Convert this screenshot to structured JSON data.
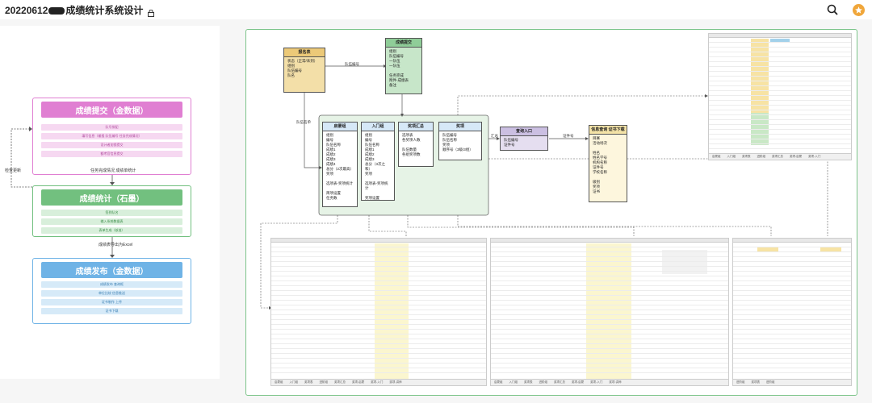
{
  "title_prefix": "20220612",
  "title_suffix": "成绩统计系统设计",
  "icons": {
    "lock": "lock-icon",
    "search": "search-icon",
    "star": "star-icon"
  },
  "colors": {
    "submit": "#e07fd2",
    "stats": "#72c07f",
    "publish": "#6fb3e6"
  },
  "flow": {
    "submit": {
      "title": "成绩提交（金数据）",
      "items": [
        "队号排配",
        "填写信息（输报 队伍编号 任务完成情况）",
        "设计者加锁提交",
        "额考官信息提交"
      ]
    },
    "stats": {
      "title": "成绩统计（石墨）",
      "items": [
        "签到队名",
        "输入系统数据表",
        "表单生成（核准）"
      ]
    },
    "publish": {
      "title": "成绩发布（金数据）",
      "items": [
        "成绩发布 查询框",
        "单位比较 信息推送",
        "证书制作 上传",
        "证书下载"
      ]
    },
    "note_between_1": "任务完成情况 成绩单统计",
    "note_between_2": "成绩表导出为Excel",
    "note_loop": "检查更新"
  },
  "diagram": {
    "registration": {
      "title": "报名表",
      "body": "状态（正常/未到）\n组别\n队伍编号\n队名"
    },
    "submission": {
      "title": "成绩提交",
      "body": "组别\n队伍编号\n一队伍\n一队伍\n\n任务完成\n附件-成绩表\n备注"
    },
    "elementary": {
      "title": "启蒙组",
      "body": "组别\n编号\n队伍名称\n成绩1\n成绩2\n成绩3\n成绩4\n总分（2次最高）\n奖项\n\n选项表-奖项统计\n\n简项设置\n任务数"
    },
    "entry": {
      "title": "入门组",
      "body": "组别\n编号\n队伍名称\n成绩1\n成绩2\n成绩3\n总分（3次之和）\n奖项\n\n选项表-奖项统计\n\n奖项设置\n任务数"
    },
    "summary": {
      "title": "奖项汇总",
      "body": "选项表\n各奖项人数\n\n队伍数量\n各组奖项数"
    },
    "awards": {
      "title": "奖项",
      "body": "队伍编号\n队伍名称\n奖项\n顺序号（3级/3组）"
    },
    "query_entry": {
      "title": "查询入口",
      "body": "队伍编号\n证件号"
    },
    "certificate": {
      "title": "信息查询 证书下载",
      "body": "目赛\n活动场次\n\n姓名\n姓名学号\n机构名称\n证件号\n学校名称\n\n级别\n奖项\n证书"
    },
    "label_team_no": "队伍编号",
    "label_team_name": "队伍名单",
    "label_summary": "汇总",
    "label_cert_no": "证件号"
  },
  "sheets": {
    "tabs_right": [
      "启蒙组",
      "入门组",
      "奖项表",
      "进阶组",
      "奖项汇总",
      "奖项-启蒙",
      "奖项-入门"
    ],
    "tabs_bottom1": [
      "启蒙组",
      "入门组",
      "奖项表",
      "进阶组",
      "奖项汇总",
      "奖项-启蒙",
      "奖项-入门",
      "奖项-讲师"
    ],
    "tabs_bottom2": [
      "启蒙组",
      "入门组",
      "奖项表",
      "进阶组",
      "奖项汇总",
      "奖项-启蒙",
      "奖项-入门",
      "奖项-讲师"
    ],
    "tabs_bottom3": [
      "进阶组",
      "奖项表",
      "进阶组"
    ]
  }
}
